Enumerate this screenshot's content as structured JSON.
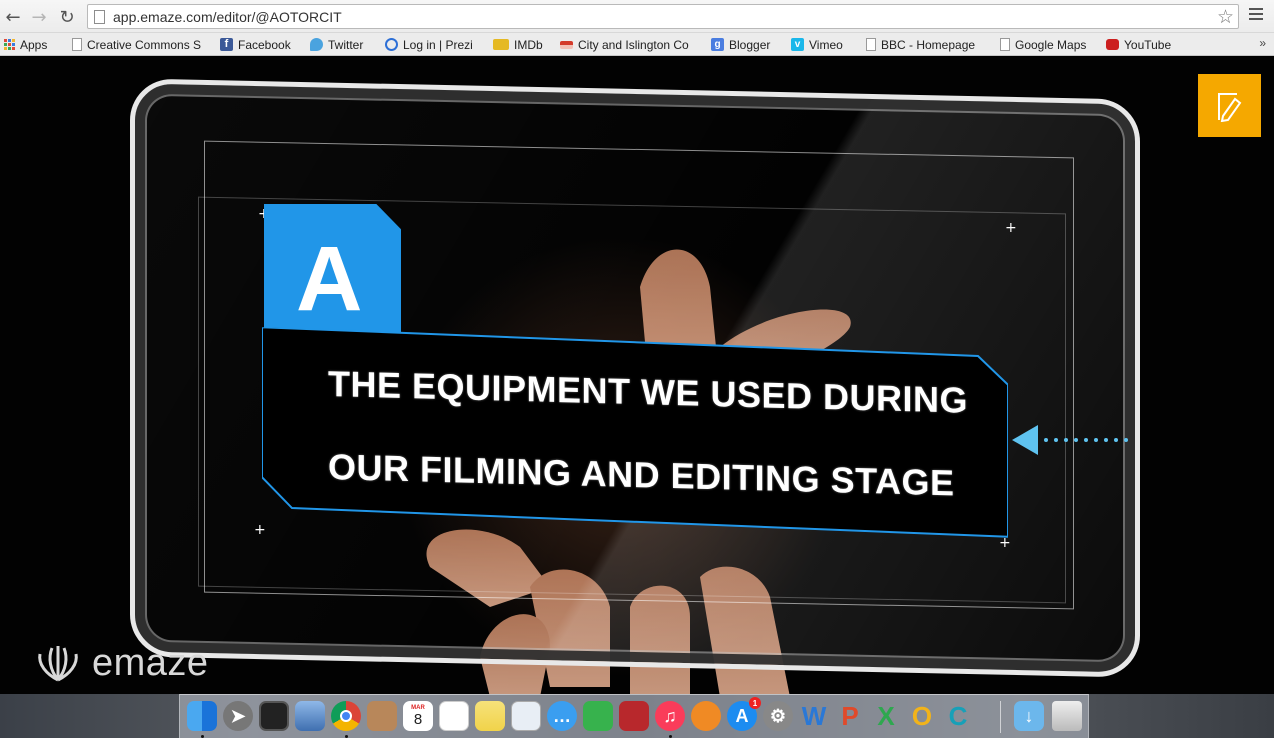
{
  "browser": {
    "url": "app.emaze.com/editor/@AOTORCIT",
    "bookmarks": [
      {
        "label": "Apps",
        "icon": "apps-grid-icon",
        "color": "#e04a3a"
      },
      {
        "label": "Creative Commons S",
        "icon": "page-icon",
        "color": "#ffffff"
      },
      {
        "label": "Facebook",
        "icon": "facebook-icon",
        "color": "#3b5998"
      },
      {
        "label": "Twitter",
        "icon": "twitter-icon",
        "color": "#4aa3df"
      },
      {
        "label": "Log in | Prezi",
        "icon": "prezi-icon",
        "color": "#2d6fd6"
      },
      {
        "label": "IMDb",
        "icon": "imdb-icon",
        "color": "#e5b923"
      },
      {
        "label": "City and Islington Co",
        "icon": "college-icon",
        "color": "#d43a2a"
      },
      {
        "label": "Blogger",
        "icon": "google-icon",
        "color": "#4a7de0"
      },
      {
        "label": "Vimeo",
        "icon": "vimeo-icon",
        "color": "#1ab7ea"
      },
      {
        "label": "BBC - Homepage",
        "icon": "page-icon",
        "color": "#ffffff"
      },
      {
        "label": "Google Maps",
        "icon": "page-icon",
        "color": "#ffffff"
      },
      {
        "label": "YouTube",
        "icon": "youtube-icon",
        "color": "#cc1f1f"
      }
    ],
    "overflow": "»"
  },
  "slide": {
    "letter": "A",
    "title_line1": "THE EQUIPMENT WE USED DURING",
    "title_line2": "OUR FILMING AND EDITING STAGE",
    "accent_color": "#2196e8",
    "logo_text": "emaze"
  },
  "dock": {
    "badge_count": "1",
    "calendar_month": "MAR",
    "calendar_day": "8"
  }
}
